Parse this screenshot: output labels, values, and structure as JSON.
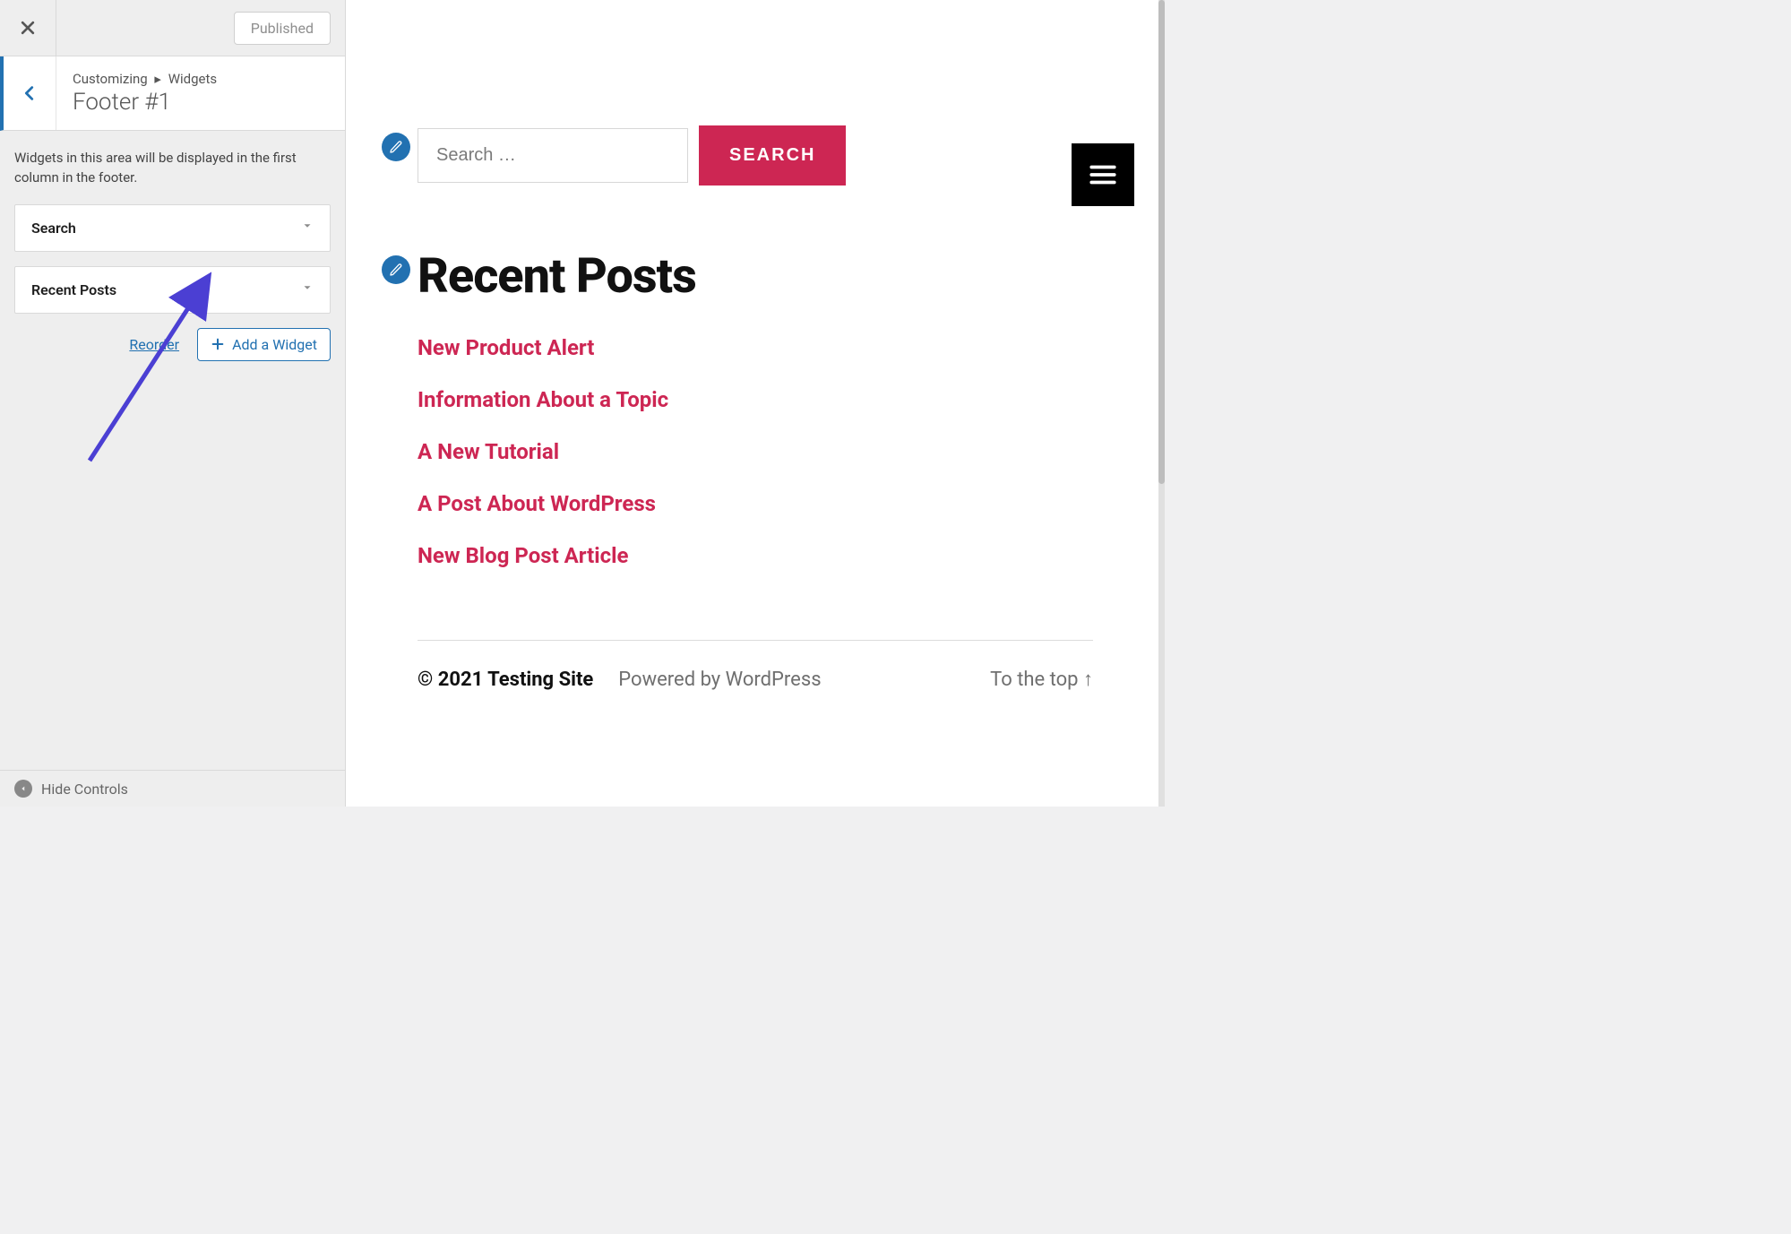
{
  "topbar": {
    "published_label": "Published"
  },
  "section": {
    "crumb_root": "Customizing",
    "crumb_current": "Widgets",
    "title": "Footer #1"
  },
  "help_text": "Widgets in this area will be displayed in the first column in the footer.",
  "widget_items": [
    {
      "label": "Search"
    },
    {
      "label": "Recent Posts"
    }
  ],
  "actions": {
    "reorder": "Reorder",
    "add_widget": "Add a Widget"
  },
  "bottombar": {
    "hide_controls": "Hide Controls"
  },
  "search_widget": {
    "placeholder": "Search …",
    "button": "SEARCH"
  },
  "recent_posts": {
    "heading": "Recent Posts",
    "items": [
      "New Product Alert",
      "Information About a Topic",
      "A New Tutorial",
      "A Post About WordPress",
      "New Blog Post Article"
    ]
  },
  "footer": {
    "copyright": "© 2021 Testing Site",
    "powered": "Powered by WordPress",
    "to_top": "To the top ↑"
  },
  "colors": {
    "accent": "#cd2653",
    "link": "#2271b1"
  }
}
